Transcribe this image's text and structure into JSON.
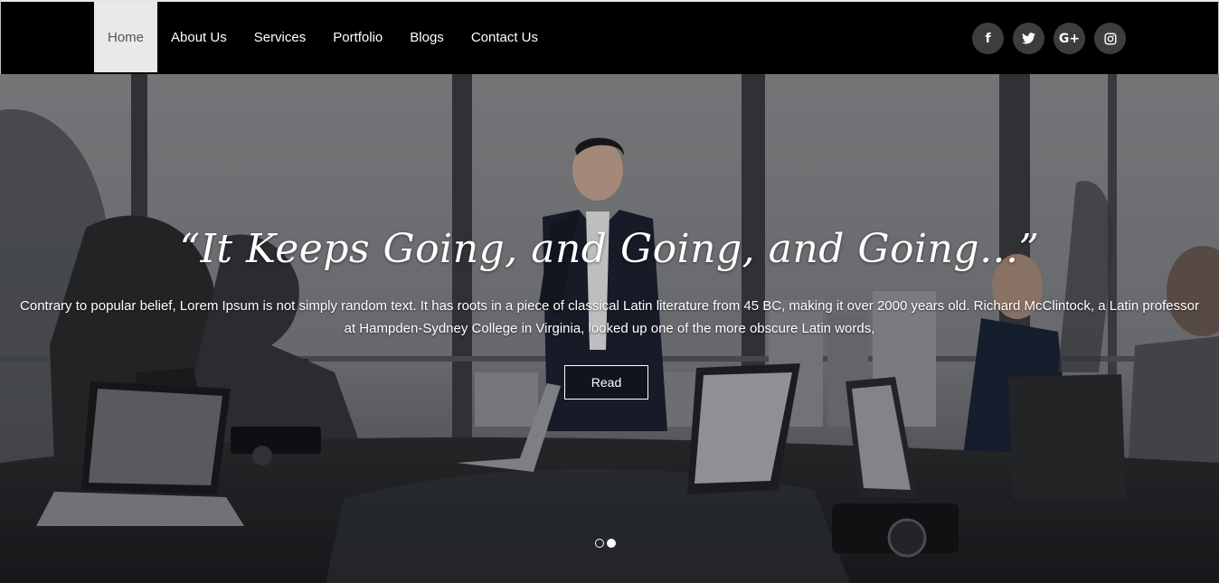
{
  "nav": {
    "items": [
      {
        "label": "Home",
        "active": true
      },
      {
        "label": "About Us",
        "active": false
      },
      {
        "label": "Services",
        "active": false
      },
      {
        "label": "Portfolio",
        "active": false
      },
      {
        "label": "Blogs",
        "active": false
      },
      {
        "label": "Contact Us",
        "active": false
      }
    ]
  },
  "social": [
    {
      "icon": "facebook-icon",
      "glyph": "f"
    },
    {
      "icon": "twitter-icon",
      "glyph": ""
    },
    {
      "icon": "google-plus-icon",
      "glyph": "G+"
    },
    {
      "icon": "instagram-icon",
      "glyph": ""
    }
  ],
  "hero": {
    "title": "“It Keeps Going, and Going, and Going...”",
    "text": "Contrary to popular belief, Lorem Ipsum is not simply random text. It has roots in a piece of classical Latin literature from 45 BC, making it over 2000 years old. Richard McClintock, a Latin professor at Hampden-Sydney College in Virginia, looked up one of the more obscure Latin words,",
    "button_label": "Read",
    "slides": 2,
    "active_slide": 2
  },
  "colors": {
    "navbar_bg": "#000000",
    "active_nav_bg": "#e9e9e9",
    "social_bg": "#3d3d3d"
  }
}
